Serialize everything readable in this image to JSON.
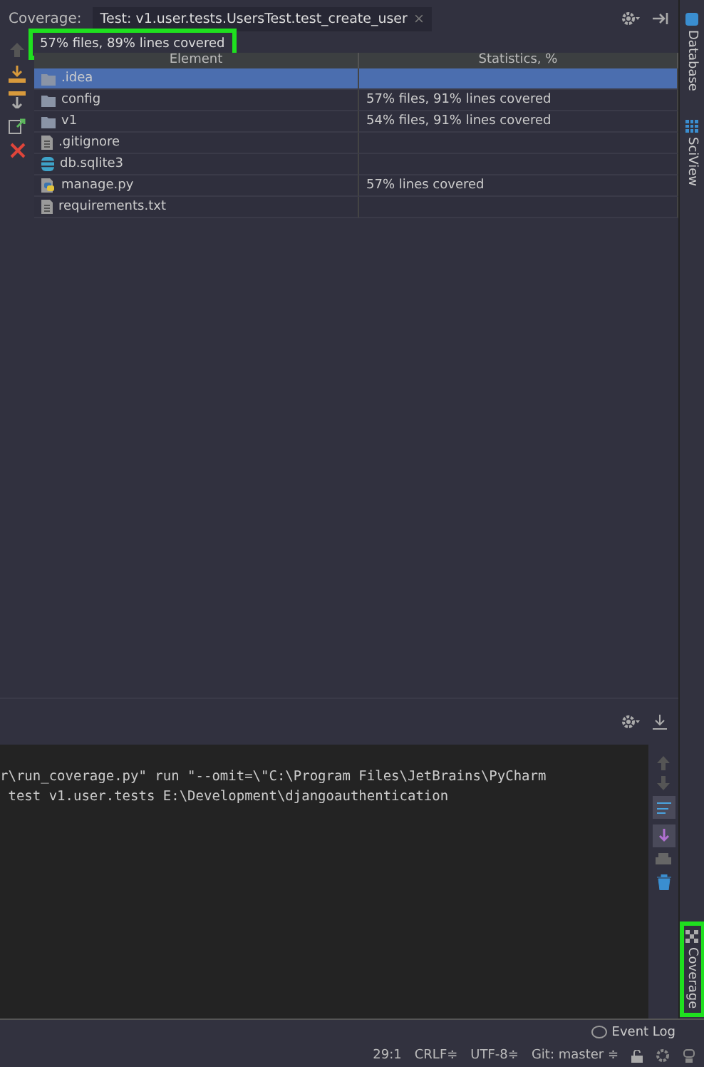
{
  "coverage": {
    "label": "Coverage:",
    "tab": {
      "title": "Test: v1.user.tests.UsersTest.test_create_user",
      "close": "×",
      "selected": true
    },
    "summary": {
      "text": "57% files, 89% lines covered",
      "highlighted": true
    },
    "columns": [
      "Element",
      "Statistics, %"
    ],
    "rows": [
      {
        "kind": "folder",
        "name": ".idea",
        "stats": "",
        "selected": true
      },
      {
        "kind": "folder",
        "name": "config",
        "stats": "57% files, 91% lines covered",
        "selected": false
      },
      {
        "kind": "folder",
        "name": "v1",
        "stats": "54% files, 91% lines covered",
        "selected": false
      },
      {
        "kind": "file",
        "name": ".gitignore",
        "stats": "",
        "selected": false
      },
      {
        "kind": "database",
        "name": "db.sqlite3",
        "stats": "",
        "selected": false
      },
      {
        "kind": "python",
        "name": "manage.py",
        "stats": "57% lines covered",
        "selected": false
      },
      {
        "kind": "file",
        "name": "requirements.txt",
        "stats": "",
        "selected": false
      }
    ]
  },
  "console": {
    "lines": [
      "r\\run_coverage.py\" run \"--omit=\\\"C:\\Program Files\\JetBrains\\PyCharm",
      " test v1.user.tests E:\\Development\\djangoauthentication"
    ]
  },
  "side_tabs": [
    {
      "kind": "database",
      "label": "Database",
      "highlighted": false
    },
    {
      "kind": "grid",
      "label": "SciView",
      "highlighted": false
    }
  ],
  "bottom_side_tab": {
    "label": "Coverage",
    "highlighted": true
  },
  "event_log": "Event Log",
  "status_bar": [
    "29:1",
    "CRLF≑",
    "UTF-8≑",
    "Git: master ≑"
  ]
}
